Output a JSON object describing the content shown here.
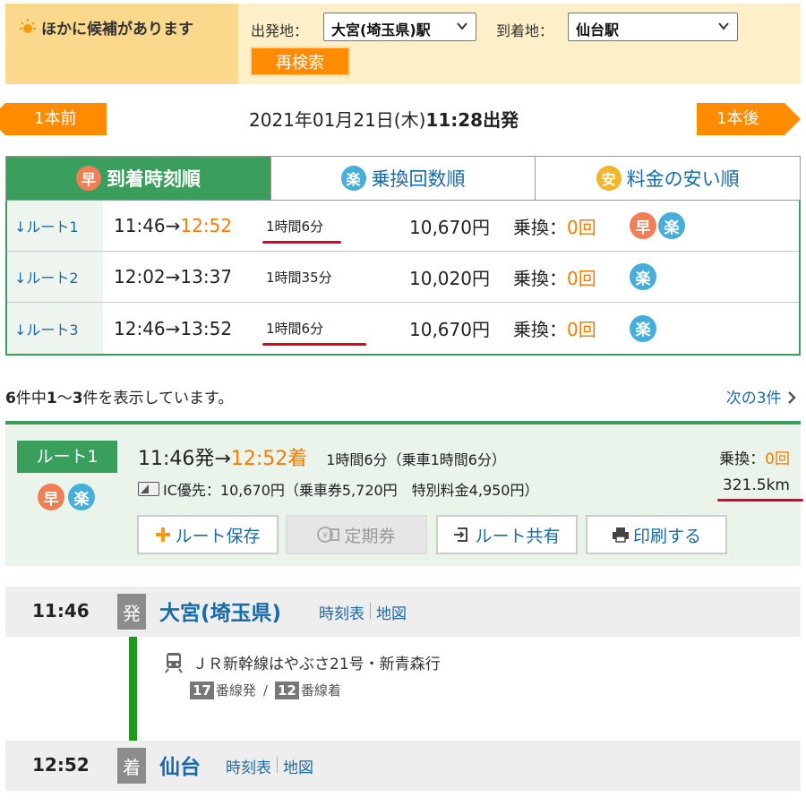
{
  "banner": {
    "title": "ほかに候補があります",
    "departure_label": "出発地：",
    "departure_value": "大宮(埼玉県)駅",
    "arrival_label": "到着地：",
    "arrival_value": "仙台駅",
    "research_label": "再検索"
  },
  "nav": {
    "prev_label": "1本前",
    "next_label": "1本後",
    "date": "2021年01月21日(木)",
    "depart_time": "11:28出発"
  },
  "tabs": [
    {
      "badge": "早",
      "label": "到着時刻順",
      "active": true
    },
    {
      "badge": "楽",
      "label": "乗換回数順",
      "active": false
    },
    {
      "badge": "安",
      "label": "料金の安い順",
      "active": false
    }
  ],
  "routes": [
    {
      "link": "↓ルート1",
      "dep": "11:46",
      "arrow": "→",
      "arr": "12:52",
      "arr_highlight": true,
      "duration": "1時間6分",
      "fare": "10,670円",
      "transfer_label": "乗換：",
      "transfer_count": "0回",
      "badges": [
        "早",
        "楽"
      ]
    },
    {
      "link": "↓ルート2",
      "dep": "12:02",
      "arrow": "→",
      "arr": "13:37",
      "arr_highlight": false,
      "duration": "1時間35分",
      "fare": "10,020円",
      "transfer_label": "乗換：",
      "transfer_count": "0回",
      "badges": [
        "楽"
      ]
    },
    {
      "link": "↓ルート3",
      "dep": "12:46",
      "arrow": "→",
      "arr": "13:52",
      "arr_highlight": false,
      "duration": "1時間6分",
      "fare": "10,670円",
      "transfer_label": "乗換：",
      "transfer_count": "0回",
      "badges": [
        "楽"
      ]
    }
  ],
  "count": {
    "total": "6",
    "part1": "件中",
    "range_start": "1",
    "range_sep": "～",
    "range_end": "3",
    "part2": "件を表示しています。",
    "next_label": "次の3件"
  },
  "detail": {
    "route_label": "ルート1",
    "badges": [
      "早",
      "楽"
    ],
    "dep": "11:46発",
    "arrow": "→",
    "arr": "12:52着",
    "duration": "1時間6分（乗車1時間6分）",
    "fare_text": "IC優先：10,670円（乗車券5,720円　特別料金4,950円）",
    "transfer_label": "乗換：",
    "transfer_count": "0回",
    "distance": "321.5km",
    "buttons": {
      "save": "ルート保存",
      "commuter": "定期券",
      "share": "ルート共有",
      "print": "印刷する"
    }
  },
  "timeline": {
    "departure": {
      "time": "11:46",
      "mark": "発",
      "station": "大宮(埼玉県)",
      "timetable": "時刻表",
      "map": "地図"
    },
    "train": "ＪＲ新幹線はやぶさ21号・新青森行",
    "platform_dep_num": "17",
    "platform_dep_label": "番線発",
    "platform_sep": "/",
    "platform_arr_num": "12",
    "platform_arr_label": "番線着",
    "arrival": {
      "time": "12:52",
      "mark": "着",
      "station": "仙台",
      "timetable": "時刻表",
      "map": "地図"
    }
  },
  "colors": {
    "accent_orange": "#ff8c00",
    "green": "#3a9e5c",
    "link_blue": "#1a6aa8",
    "highlight_red": "#e0002a"
  }
}
